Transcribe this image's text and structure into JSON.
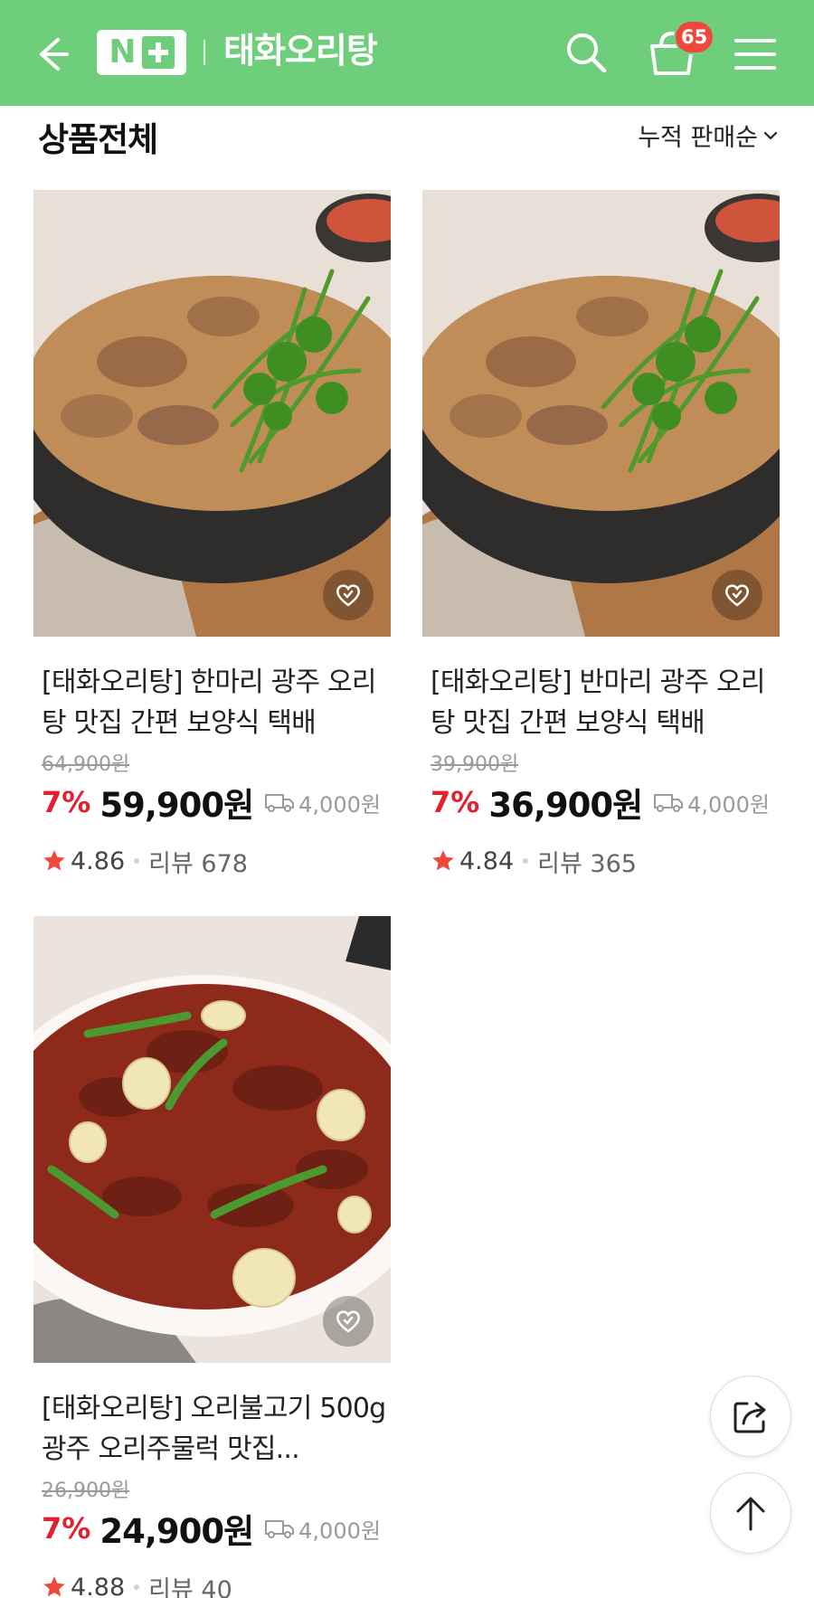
{
  "header": {
    "brand_logo_text": "N",
    "store_name": "태화오리탕",
    "cart_count": "65",
    "background_color": "#6fce7c"
  },
  "section": {
    "title": "상품전체",
    "sort_label": "누적 판매순"
  },
  "products": [
    {
      "name": "[태화오리탕] 한마리 광주 오리탕 맛집 간편 보양식 택배",
      "original_price": "64,900원",
      "discount": "7%",
      "price": "59,900원",
      "shipping": "4,000원",
      "rating": "4.86",
      "review_label": "리뷰 678"
    },
    {
      "name": "[태화오리탕] 반마리 광주 오리탕 맛집 간편 보양식 택배",
      "original_price": "39,900원",
      "discount": "7%",
      "price": "36,900원",
      "shipping": "4,000원",
      "rating": "4.84",
      "review_label": "리뷰 365"
    },
    {
      "name": "[태화오리탕] 오리불고기 500g 광주 오리주물럭 맛집...",
      "original_price": "26,900원",
      "discount": "7%",
      "price": "24,900원",
      "shipping": "4,000원",
      "rating": "4.88",
      "review_label": "리뷰 40"
    }
  ],
  "icons": {
    "back": "arrow-left-icon",
    "search": "search-icon",
    "cart": "cart-icon",
    "menu": "hamburger-icon",
    "wishlist": "heart-icon",
    "shipping": "truck-icon",
    "rating": "star-icon",
    "share": "share-icon",
    "scroll_top": "arrow-up-icon"
  },
  "colors": {
    "accent": "#6fce7c",
    "discount": "#e3202f",
    "star": "#f0473d",
    "badge": "#f0473d"
  }
}
